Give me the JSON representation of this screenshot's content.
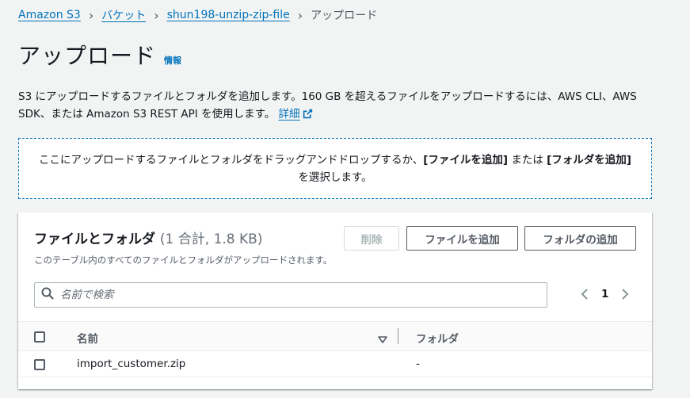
{
  "breadcrumb": {
    "items": [
      "Amazon S3",
      "バケット",
      "shun198-unzip-zip-file"
    ],
    "current": "アップロード"
  },
  "page": {
    "title": "アップロード",
    "info_label": "情報"
  },
  "description": {
    "text": "S3 にアップロードするファイルとフォルダを追加します。160 GB を超えるファイルをアップロードするには、AWS CLI、AWS SDK、または Amazon S3 REST API を使用します。",
    "link_label": "詳細"
  },
  "dropzone": {
    "text_before": "ここにアップロードするファイルとフォルダをドラッグアンドドロップするか、",
    "add_files": "[ファイルを追加]",
    "text_or": " または ",
    "add_folder": "[フォルダを追加]",
    "text_after": " を選択します。"
  },
  "files_panel": {
    "title": "ファイルとフォルダ",
    "count": "(1 合計, 1.8 KB)",
    "subtitle": "このテーブル内のすべてのファイルとフォルダがアップロードされます。",
    "delete_label": "削除",
    "add_files_label": "ファイルを追加",
    "add_folder_label": "フォルダの追加",
    "search_placeholder": "名前で検索",
    "page_number": "1",
    "columns": [
      "名前",
      "フォルダ"
    ],
    "rows": [
      {
        "name": "import_customer.zip",
        "folder": "-"
      }
    ]
  },
  "colors": {
    "link": "#0073bb",
    "text": "#16191f",
    "muted": "#545b64",
    "background": "#f2f3f3"
  },
  "icons": {
    "external_link": "external-link-icon",
    "search": "search-icon",
    "chevron_left": "chevron-left-icon",
    "chevron_right": "chevron-right-icon",
    "sort": "sort-down-icon"
  }
}
